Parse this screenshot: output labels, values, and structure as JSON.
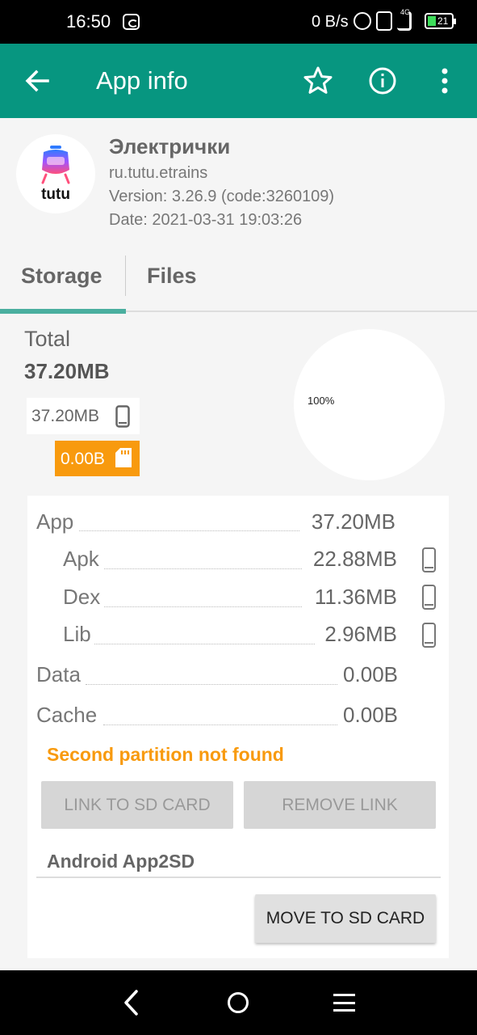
{
  "status_bar": {
    "time": "16:50",
    "net_speed": "0 B/s",
    "network": "4G",
    "battery": "21"
  },
  "toolbar": {
    "title": "App info",
    "icons": [
      "arrow-back-icon",
      "star-outline-icon",
      "info-icon",
      "more-vert-icon"
    ]
  },
  "app": {
    "name": "Электрички",
    "package": "ru.tutu.etrains",
    "version": "Version: 3.26.9 (code:3260109)",
    "date": "Date: 2021-03-31 19:03:26",
    "icon_text": "tutu"
  },
  "tabs": [
    {
      "label": "Storage",
      "selected": true
    },
    {
      "label": "Files",
      "selected": false
    }
  ],
  "total": {
    "label": "Total",
    "value": "37.20MB",
    "internal": "37.20MB",
    "sd": "0.00B",
    "pie_label": "100%"
  },
  "breakdown": {
    "app": {
      "label": "App",
      "value": "37.20MB"
    },
    "apk": {
      "label": "Apk",
      "value": "22.88MB"
    },
    "dex": {
      "label": "Dex",
      "value": "11.36MB"
    },
    "lib": {
      "label": "Lib",
      "value": "2.96MB"
    },
    "data": {
      "label": "Data",
      "value": "0.00B"
    },
    "cache": {
      "label": "Cache",
      "value": "0.00B"
    }
  },
  "warning": "Second partition not found",
  "buttons": {
    "link": "LINK TO SD CARD",
    "remove": "REMOVE LINK",
    "move": "MOVE TO SD CARD"
  },
  "section": {
    "title": "Android App2SD"
  },
  "colors": {
    "toolbar": "#079680",
    "accent_orange": "#F89A0E",
    "tab_indicator": "#4AAF9F"
  }
}
